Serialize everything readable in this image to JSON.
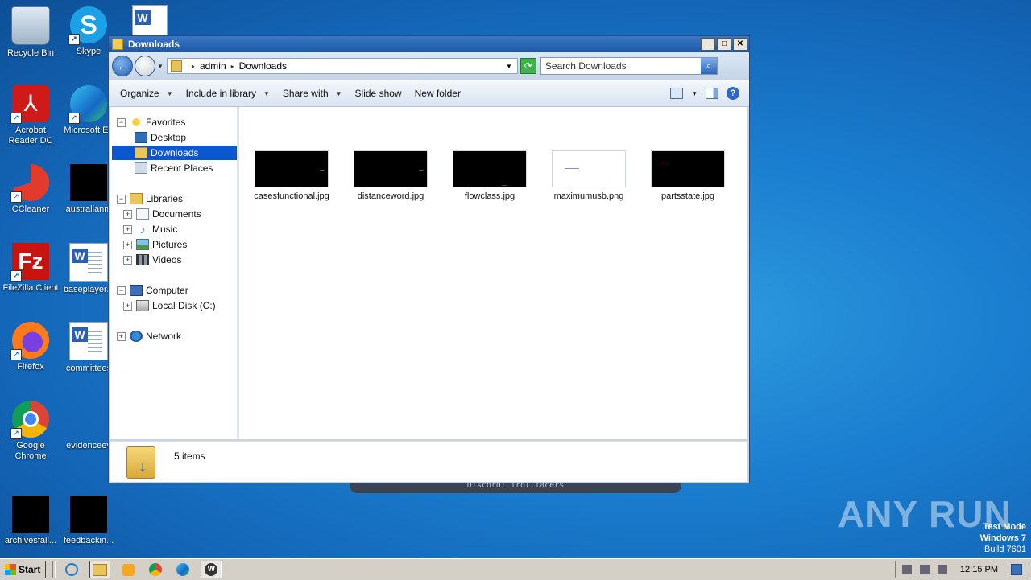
{
  "desktop": {
    "icons": [
      {
        "label": "Recycle Bin"
      },
      {
        "label": "Skype"
      },
      {
        "label": "Acrobat Reader DC"
      },
      {
        "label": "Microsoft Ed"
      },
      {
        "label": "CCleaner"
      },
      {
        "label": "australianm"
      },
      {
        "label": "FileZilla Client"
      },
      {
        "label": "baseplayer..."
      },
      {
        "label": "Firefox"
      },
      {
        "label": "committees"
      },
      {
        "label": "Google Chrome"
      },
      {
        "label": "evidenceev"
      },
      {
        "label": "archivesfall..."
      },
      {
        "label": "feedbackin..."
      }
    ],
    "banner_text": "Discord: Trollfacers",
    "watermark": "ANY RUN",
    "test_mode": {
      "line1": "Test Mode",
      "line2": "Windows 7",
      "line3": "Build 7601"
    }
  },
  "window": {
    "title": "Downloads",
    "controls": {
      "minimize": "_",
      "maximize": "□",
      "close": "✕"
    },
    "address": {
      "segments": [
        "admin",
        "Downloads"
      ]
    },
    "search": {
      "placeholder": "Search Downloads"
    },
    "toolbar": {
      "organize": "Organize",
      "include_in_library": "Include in library",
      "share_with": "Share with",
      "slide_show": "Slide show",
      "new_folder": "New folder",
      "help": "?"
    },
    "nav": {
      "favorites": "Favorites",
      "desktop": "Desktop",
      "downloads": "Downloads",
      "recent_places": "Recent Places",
      "libraries": "Libraries",
      "documents": "Documents",
      "music": "Music",
      "pictures": "Pictures",
      "videos": "Videos",
      "computer": "Computer",
      "local_disk": "Local Disk (C:)",
      "network": "Network"
    },
    "files": [
      {
        "name": "casesfunctional.jpg",
        "thumb": "dark"
      },
      {
        "name": "distanceword.jpg",
        "thumb": "dark"
      },
      {
        "name": "flowclass.jpg",
        "thumb": "dark"
      },
      {
        "name": "maximumusb.png",
        "thumb": "light"
      },
      {
        "name": "partsstate.jpg",
        "thumb": "dark"
      }
    ],
    "status": {
      "count": "5 items"
    }
  },
  "taskbar": {
    "start": "Start",
    "clock": "12:15 PM"
  }
}
